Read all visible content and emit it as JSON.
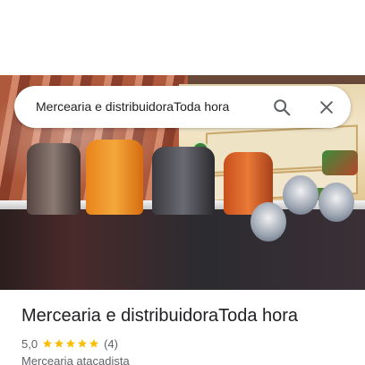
{
  "search": {
    "query": "Mercearia e distribuidoraToda hora"
  },
  "place": {
    "name": "Mercearia e distribuidoraToda hora",
    "rating": "5,0",
    "review_count": "(4)",
    "category": "Mercearia atacadista",
    "stars": 5
  },
  "icons": {
    "search": "search-icon",
    "close": "close-icon",
    "star": "star-icon"
  },
  "colors": {
    "star": "#fbbc04",
    "icon": "#5f6368",
    "text_primary": "#202124",
    "text_secondary": "#5f6368"
  }
}
